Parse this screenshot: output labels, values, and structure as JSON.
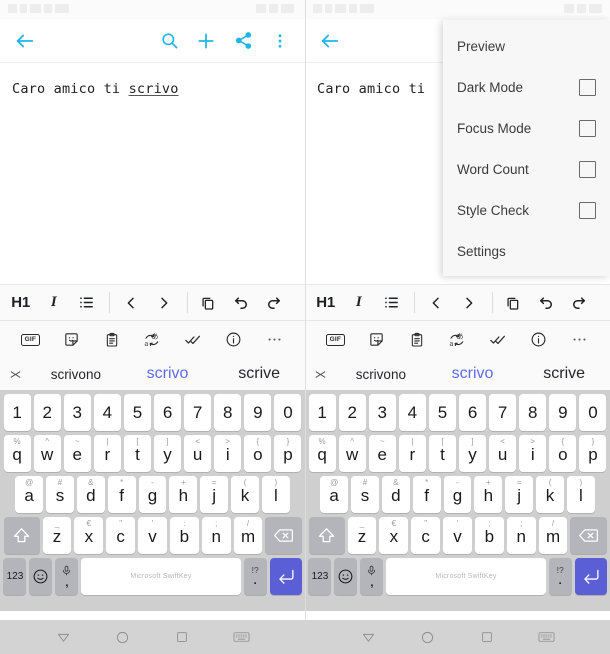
{
  "status_bar": {
    "left_text": "",
    "right_text": ""
  },
  "app_bar": {
    "back_label": "back-arrow",
    "search_label": "search",
    "add_label": "add",
    "share_label": "share",
    "overflow_label": "more options",
    "accent_color": "#1fb6e8"
  },
  "document": {
    "text_before": "Caro amico ti ",
    "misspelled_word": "scrivo",
    "right_panel_text": "Caro amico ti"
  },
  "menu": {
    "items": [
      {
        "label": "Preview",
        "has_checkbox": false,
        "checked": false
      },
      {
        "label": "Dark Mode",
        "has_checkbox": true,
        "checked": false
      },
      {
        "label": "Focus Mode",
        "has_checkbox": true,
        "checked": false
      },
      {
        "label": "Word Count",
        "has_checkbox": true,
        "checked": false
      },
      {
        "label": "Style Check",
        "has_checkbox": true,
        "checked": false
      },
      {
        "label": "Settings",
        "has_checkbox": false,
        "checked": false
      }
    ]
  },
  "format_toolbar": {
    "heading_label": "H1",
    "italic_label": "I",
    "icons": [
      "bullet-list-icon",
      "chevron-left-icon",
      "chevron-right-icon",
      "copy-icon",
      "undo-icon",
      "redo-icon"
    ]
  },
  "swiftkey_toolbar": {
    "gif_label": "GIF",
    "icons": [
      "gif-icon",
      "sticker-icon",
      "clipboard-icon",
      "translate-icon",
      "editor-check-icon",
      "info-icon",
      "more-icon"
    ]
  },
  "predictions": {
    "close_label": "close-predictions",
    "items": [
      {
        "text": "scrivono",
        "highlighted": false
      },
      {
        "text": "scrivo",
        "highlighted": true
      },
      {
        "text": "scrive",
        "highlighted": false
      }
    ]
  },
  "keyboard": {
    "brand": "Microsoft SwiftKey",
    "numbers_label": "123",
    "rows": [
      {
        "name": "number-row",
        "keys": [
          {
            "main": "1"
          },
          {
            "main": "2"
          },
          {
            "main": "3"
          },
          {
            "main": "4"
          },
          {
            "main": "5"
          },
          {
            "main": "6"
          },
          {
            "main": "7"
          },
          {
            "main": "8"
          },
          {
            "main": "9"
          },
          {
            "main": "0"
          }
        ]
      },
      {
        "name": "qwerty-row",
        "keys": [
          {
            "main": "q",
            "sub": "%"
          },
          {
            "main": "w",
            "sub": "^"
          },
          {
            "main": "e",
            "sub": "~"
          },
          {
            "main": "r",
            "sub": "|"
          },
          {
            "main": "t",
            "sub": "["
          },
          {
            "main": "y",
            "sub": "]"
          },
          {
            "main": "u",
            "sub": "<"
          },
          {
            "main": "i",
            "sub": ">"
          },
          {
            "main": "o",
            "sub": "{"
          },
          {
            "main": "p",
            "sub": "}"
          }
        ]
      },
      {
        "name": "asdf-row",
        "keys": [
          {
            "main": "a",
            "sub": "@"
          },
          {
            "main": "s",
            "sub": "#"
          },
          {
            "main": "d",
            "sub": "&"
          },
          {
            "main": "f",
            "sub": "*"
          },
          {
            "main": "g",
            "sub": "-"
          },
          {
            "main": "h",
            "sub": "+"
          },
          {
            "main": "j",
            "sub": "="
          },
          {
            "main": "k",
            "sub": "("
          },
          {
            "main": "l",
            "sub": ")"
          }
        ]
      },
      {
        "name": "zxcv-row",
        "keys": [
          {
            "main": "z",
            "sub": "_"
          },
          {
            "main": "x",
            "sub": "€"
          },
          {
            "main": "c",
            "sub": "\""
          },
          {
            "main": "v",
            "sub": "'"
          },
          {
            "main": "b",
            "sub": ":"
          },
          {
            "main": "n",
            "sub": ";"
          },
          {
            "main": "m",
            "sub": "/"
          }
        ]
      }
    ],
    "bottom_row": {
      "numbers": "123",
      "emoji": "emoji-icon",
      "mic_sub": ",",
      "space_label": "Microsoft SwiftKey",
      "punct_top": "!?",
      "punct_bot": ".",
      "enter": "enter-icon",
      "shift": "shift-icon",
      "backspace": "backspace-icon",
      "enter_color": "#5b5fd6"
    }
  },
  "nav_bar": {
    "back_label": "nav-back",
    "home_label": "nav-home",
    "recents_label": "nav-recents",
    "keyboard_label": "nav-keyboard"
  }
}
